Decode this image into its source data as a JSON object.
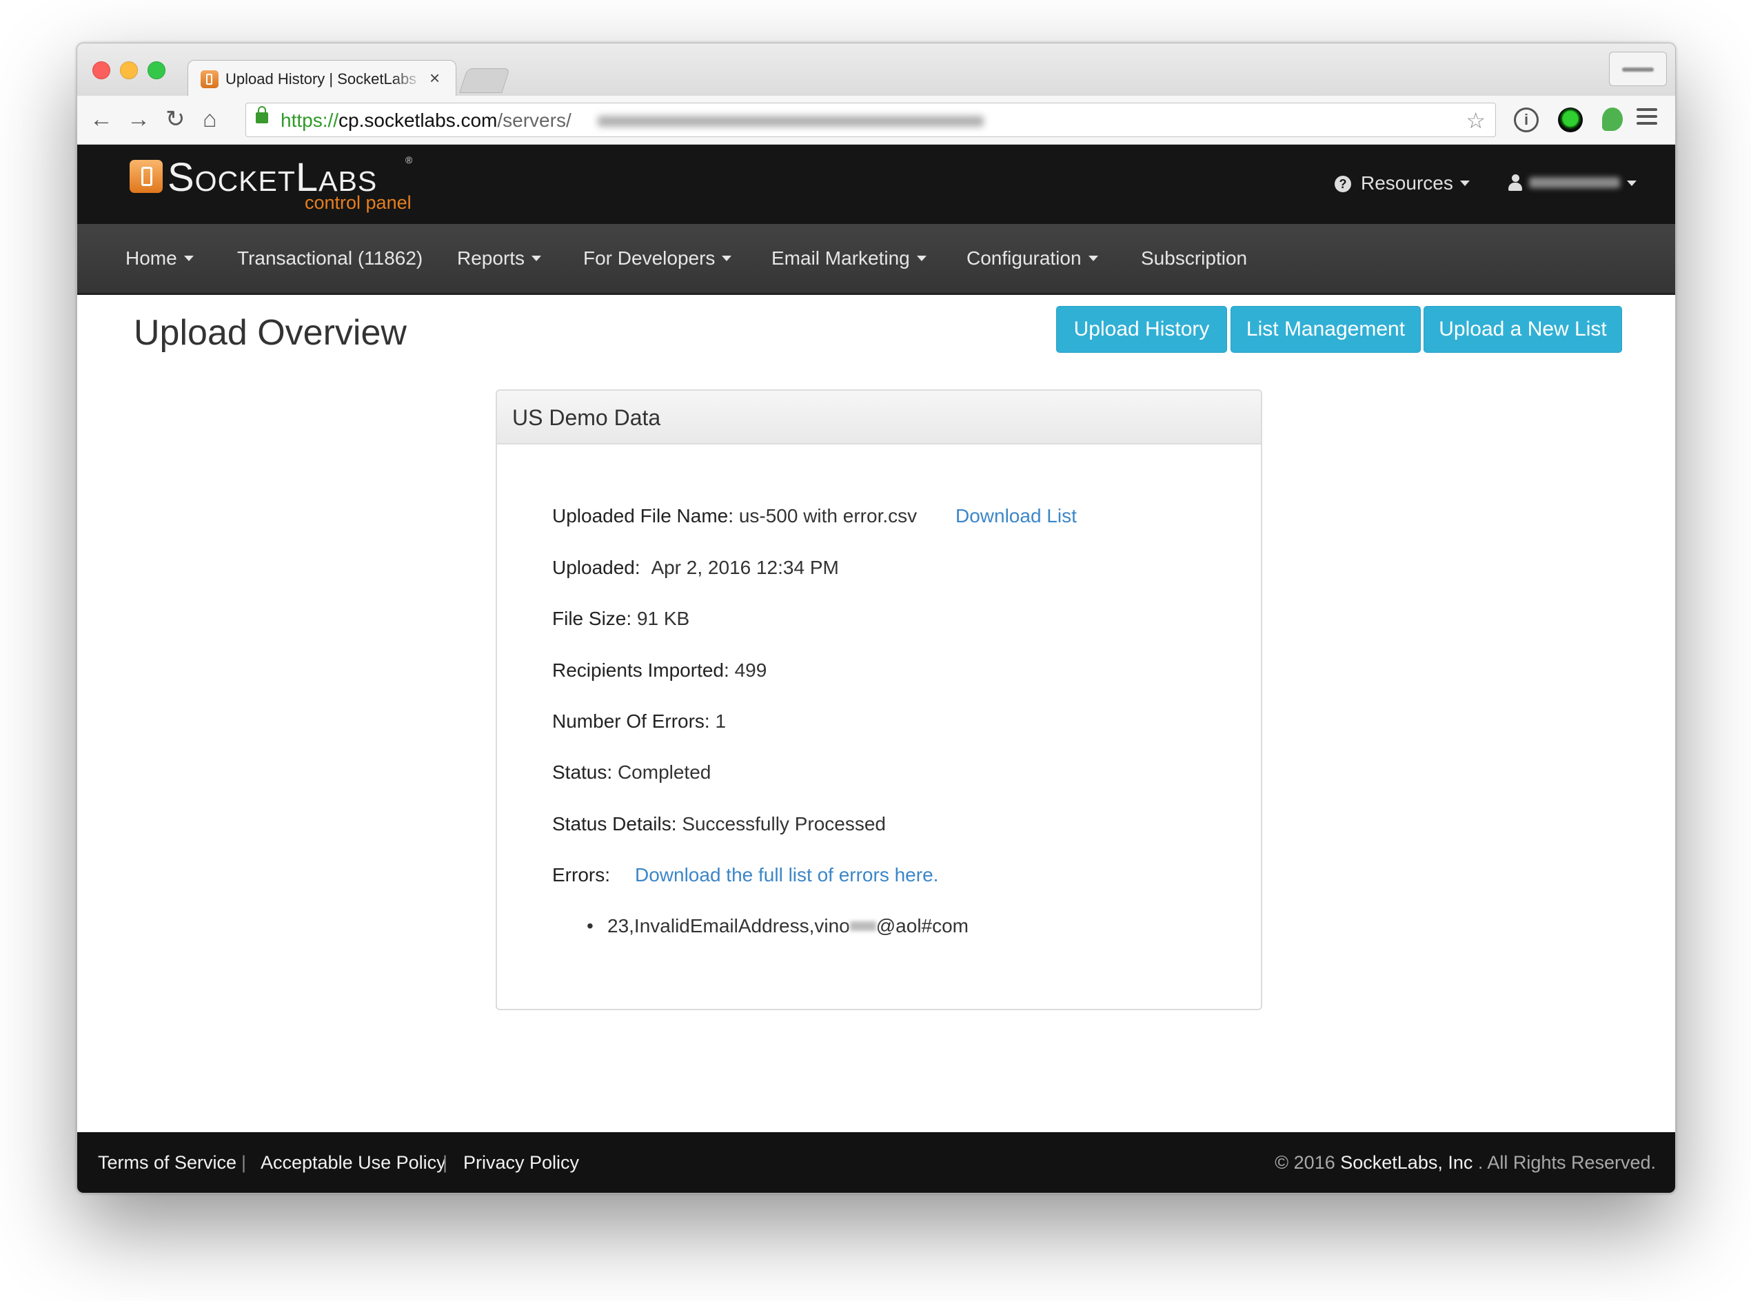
{
  "browser": {
    "tab_title": "Upload History | SocketLabs",
    "url_scheme": "https://",
    "url_host": "cp.socketlabs.com",
    "url_path": "/servers/"
  },
  "header": {
    "logo_main": "SocketLabs",
    "logo_sub": "control panel",
    "resources_label": "Resources",
    "colors": {
      "background": "#151515",
      "logo_orange": "#e67f1f"
    }
  },
  "nav": {
    "items": [
      {
        "label": "Home",
        "dropdown": true
      },
      {
        "label": "Transactional (11862)",
        "dropdown": false
      },
      {
        "label": "Reports",
        "dropdown": true
      },
      {
        "label": "For Developers",
        "dropdown": true
      },
      {
        "label": "Email Marketing",
        "dropdown": true
      },
      {
        "label": "Configuration",
        "dropdown": true
      },
      {
        "label": "Subscription",
        "dropdown": false
      }
    ]
  },
  "page": {
    "title": "Upload Overview",
    "buttons": {
      "upload_history": "Upload History",
      "list_management": "List Management",
      "upload_new_list": "Upload a New List"
    },
    "button_color": "#31b0d5"
  },
  "panel": {
    "heading": "US Demo Data",
    "file_name_label": "Uploaded File Name:",
    "file_name_value": "us-500 with error.csv",
    "download_list": "Download List",
    "uploaded_label": "Uploaded:",
    "uploaded_value": "Apr 2, 2016 12:34 PM",
    "file_size_label": "File Size:",
    "file_size_value": "91 KB",
    "recipients_label": "Recipients Imported:",
    "recipients_value": "499",
    "errors_count_label": "Number Of Errors:",
    "errors_count_value": "1",
    "status_label": "Status:",
    "status_value": "Completed",
    "status_details_label": "Status Details:",
    "status_details_value": "Successfully Processed",
    "errors_label": "Errors:",
    "errors_link": "Download the full list of errors here.",
    "error_items": [
      {
        "before": "23,InvalidEmailAddress,vino",
        "after": "@aol#com"
      }
    ],
    "link_color": "#3c86c8"
  },
  "footer": {
    "links": [
      "Terms of Service",
      "Acceptable Use Policy",
      "Privacy Policy"
    ],
    "separator": "|",
    "copyright_prefix": "© 2016",
    "company": "SocketLabs, Inc",
    "copyright_suffix": ". All Rights Reserved."
  }
}
